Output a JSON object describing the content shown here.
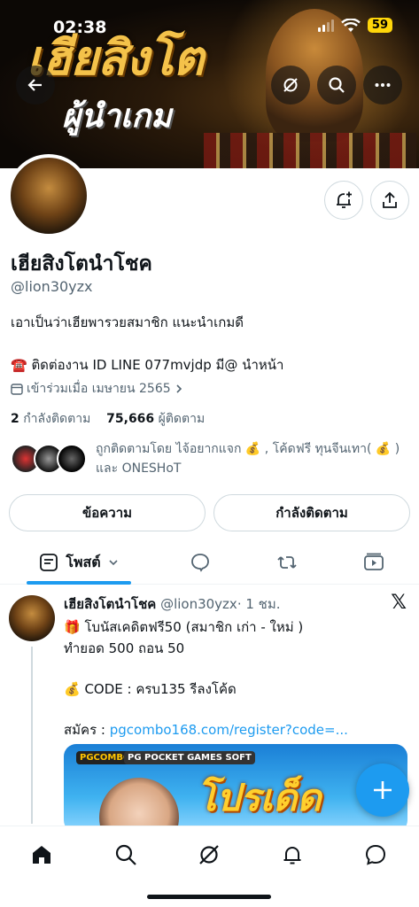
{
  "status_bar": {
    "time": "02:38",
    "battery": "59"
  },
  "banner": {
    "title_line1": "เฮียสิงโต",
    "title_line2": "ผู้นำเกม"
  },
  "profile": {
    "name": "เฮียสิงโตนำโชค",
    "handle": "@lion30yzx",
    "bio": "เอาเป็นว่าเฮียพารวยสมาชิก แนะนำเกมดี",
    "contact": "☎️ ติดต่องาน ID LINE 077mvjdp มี@ นำหน้า",
    "joined": "เข้าร่วมเมื่อ เมษายน 2565",
    "following_count": "2",
    "following_label": "กำลังติดตาม",
    "followers_count": "75,666",
    "followers_label": "ผู้ติดตาม",
    "followed_by": "ถูกติดตามโดย ไจ้อยากแจก 💰 , โค้ดฟรี ทุนจีนเทา( 💰 ) และ ONESHoT"
  },
  "buttons": {
    "message": "ข้อความ",
    "following": "กำลังติดตาม"
  },
  "tabs": {
    "posts": "โพสต์"
  },
  "post": {
    "author": "เฮียสิงโตนำโชค",
    "handle": "@lion30yzx",
    "time": "· 1 ชม.",
    "line1": "🎁 โบนัสเคดิตฟรี50 (สมาชิก เก่า - ใหม่ )",
    "line2": "ทำยอด 500 ถอน 50",
    "line3": "💰 CODE : ครบ135  รีลงโค้ด",
    "register_label": "สมัคร :",
    "register_link": "pgcombo168.com/register?code=...",
    "image_tag1": "PGCOMBO 168",
    "image_tag2": "PG POCKET GAMES SOFT",
    "image_promo": "โปรเด็ด"
  },
  "colors": {
    "accent": "#1d9bf0",
    "text": "#0f1419",
    "muted": "#536471",
    "banner_gold": "#f4c24a"
  }
}
